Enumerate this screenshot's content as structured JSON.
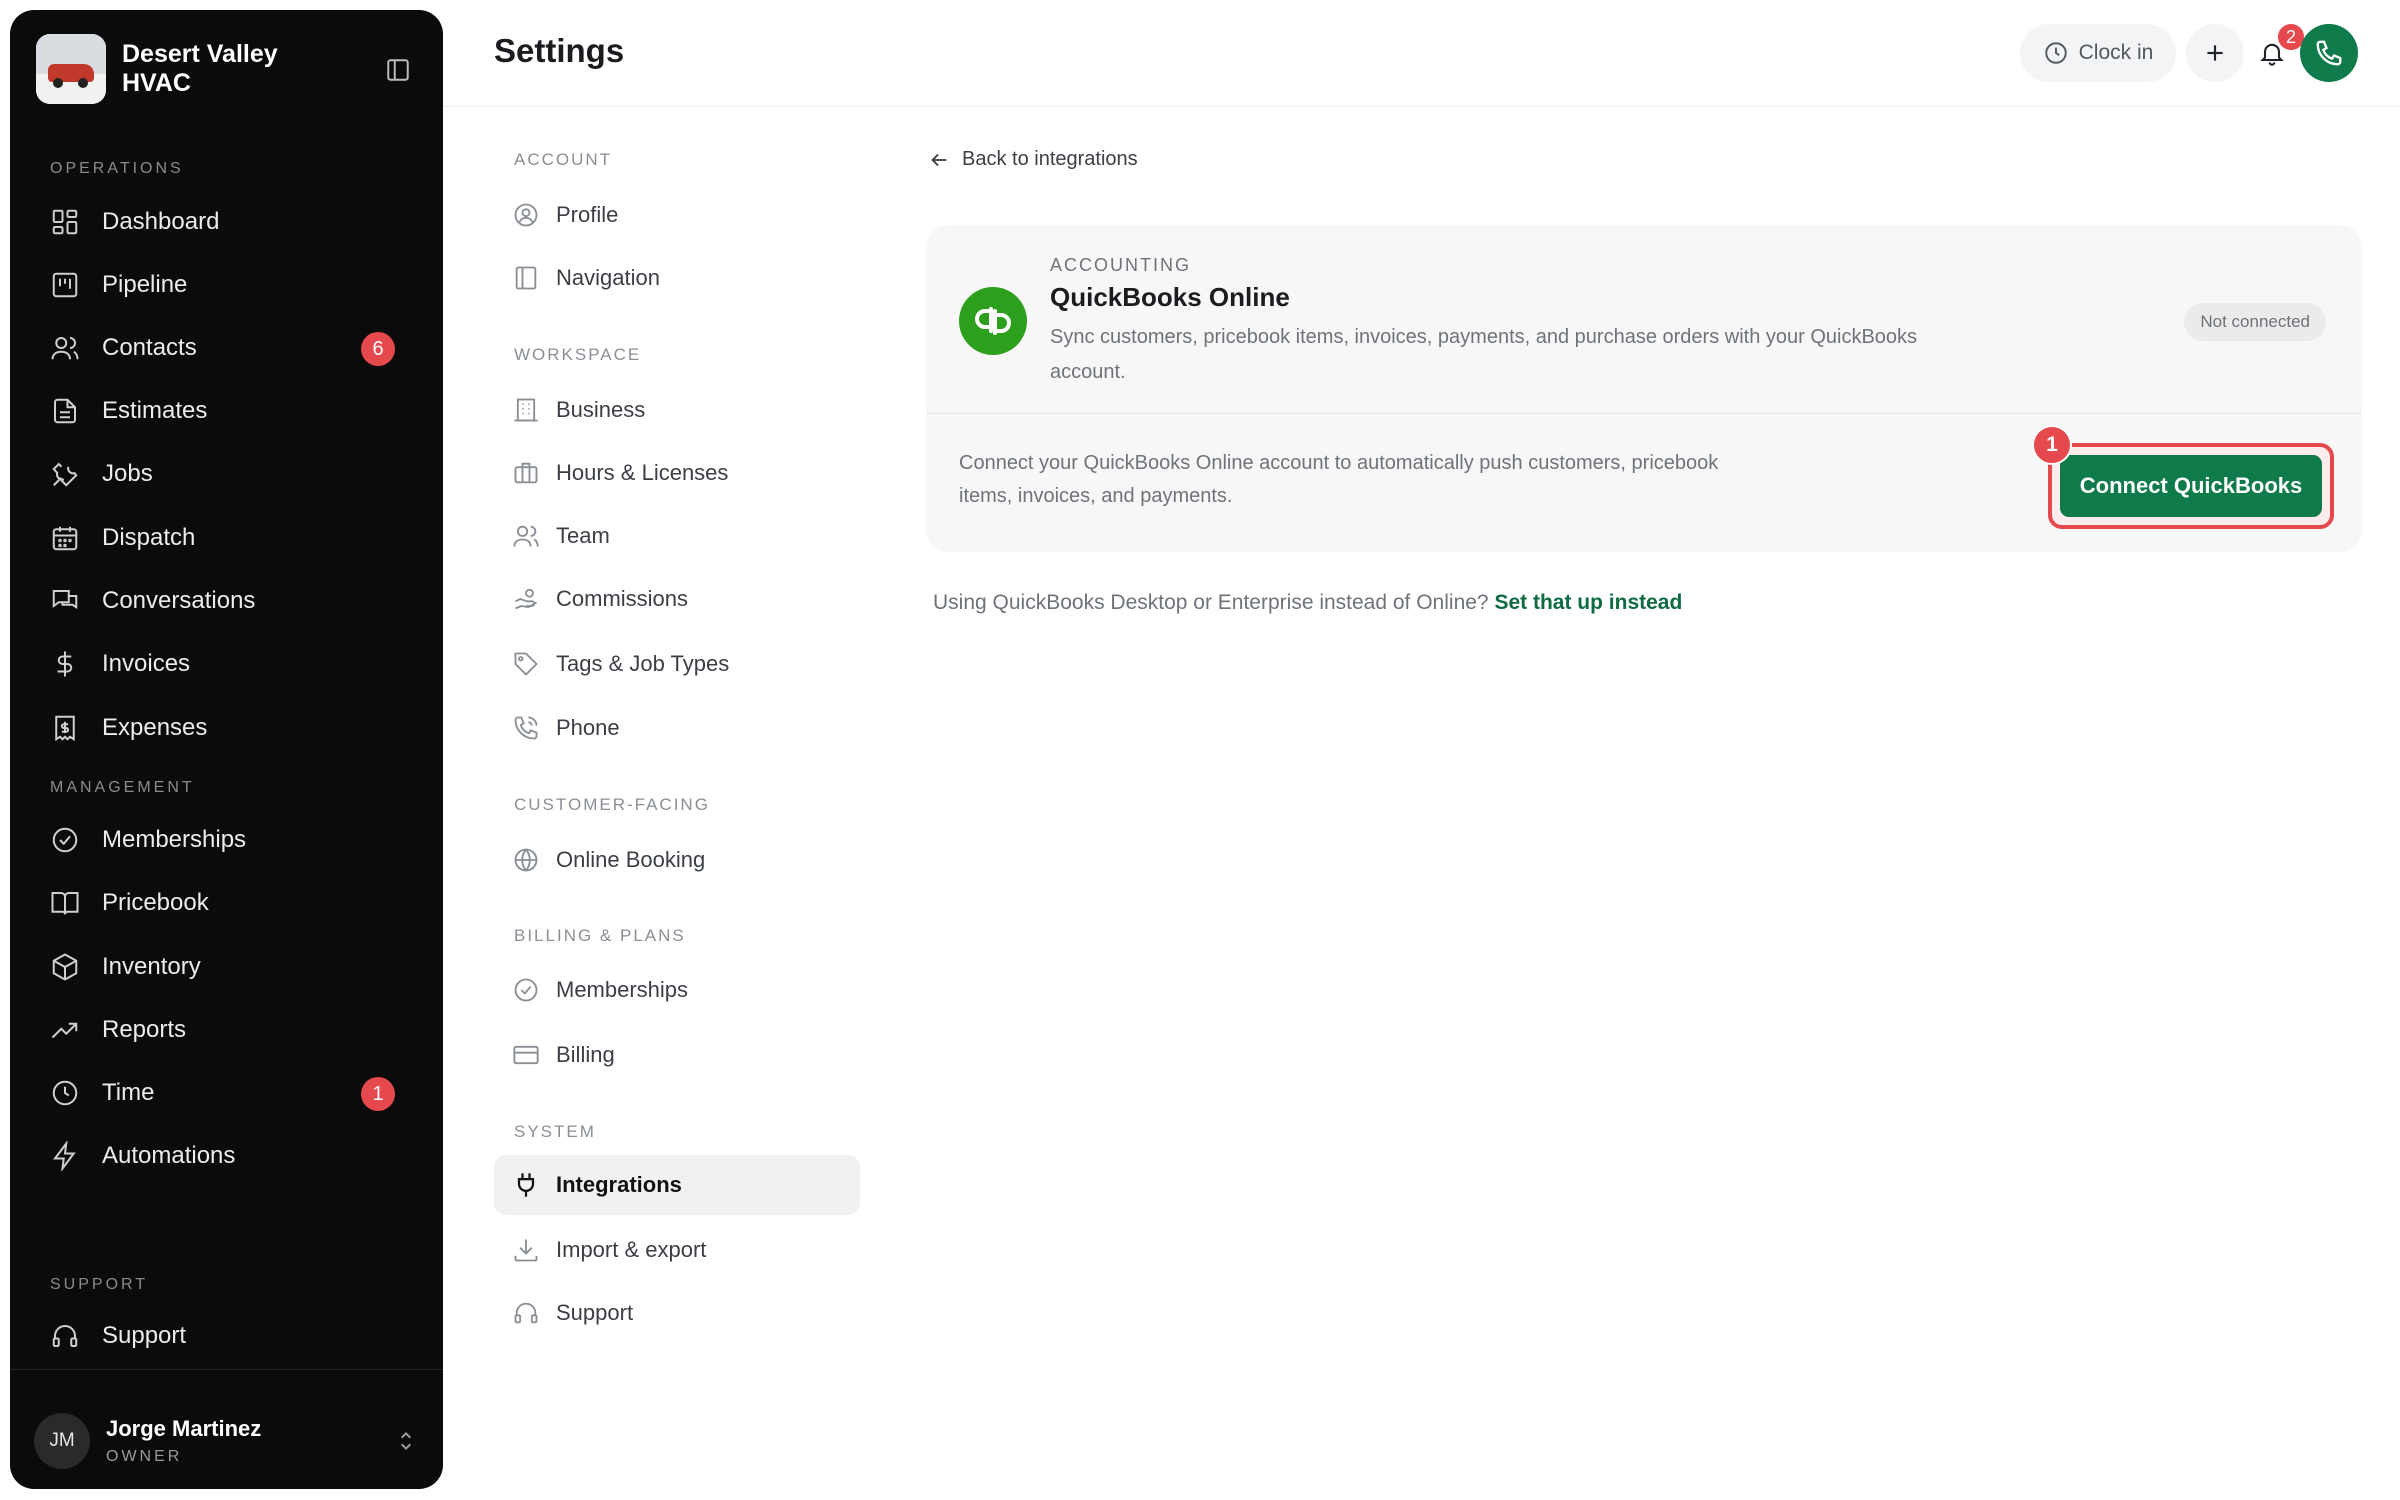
{
  "sidebar": {
    "brand_name": "Desert Valley HVAC",
    "sections": {
      "operations": "OPERATIONS",
      "management": "MANAGEMENT",
      "support": "SUPPORT"
    },
    "items": {
      "dashboard": "Dashboard",
      "pipeline": "Pipeline",
      "contacts": "Contacts",
      "estimates": "Estimates",
      "jobs": "Jobs",
      "dispatch": "Dispatch",
      "conversations": "Conversations",
      "invoices": "Invoices",
      "expenses": "Expenses",
      "memberships": "Memberships",
      "pricebook": "Pricebook",
      "inventory": "Inventory",
      "reports": "Reports",
      "time": "Time",
      "automations": "Automations",
      "support": "Support"
    },
    "badges": {
      "contacts": "6",
      "time": "1"
    },
    "user": {
      "initials": "JM",
      "name": "Jorge Martinez",
      "role": "OWNER"
    }
  },
  "header": {
    "title": "Settings",
    "clock_in": "Clock in",
    "notification_count": "2"
  },
  "settings_nav": {
    "sections": {
      "account": "ACCOUNT",
      "workspace": "WORKSPACE",
      "customer_facing": "CUSTOMER-FACING",
      "billing": "BILLING & PLANS",
      "system": "SYSTEM"
    },
    "items": {
      "profile": "Profile",
      "navigation": "Navigation",
      "business": "Business",
      "hours": "Hours & Licenses",
      "team": "Team",
      "commissions": "Commissions",
      "tags": "Tags & Job Types",
      "phone": "Phone",
      "online_booking": "Online Booking",
      "memberships": "Memberships",
      "billing": "Billing",
      "integrations": "Integrations",
      "import_export": "Import & export",
      "support": "Support"
    }
  },
  "main": {
    "back_link": "Back to integrations",
    "card": {
      "eyebrow": "ACCOUNTING",
      "title": "QuickBooks Online",
      "description": "Sync customers, pricebook items, invoices, payments, and purchase orders with your QuickBooks account.",
      "status": "Not connected",
      "body": "Connect your QuickBooks Online account to automatically push customers, pricebook items, invoices, and payments.",
      "connect_label": "Connect QuickBooks",
      "step_number": "1"
    },
    "footnote_text": "Using QuickBooks Desktop or Enterprise instead of Online?",
    "footnote_link": "Set that up instead"
  },
  "colors": {
    "sidebar_bg": "#0b0b0b",
    "accent_green": "#0f7a4a",
    "quickbooks_green": "#2ca01c",
    "badge_red": "#e5484d"
  }
}
